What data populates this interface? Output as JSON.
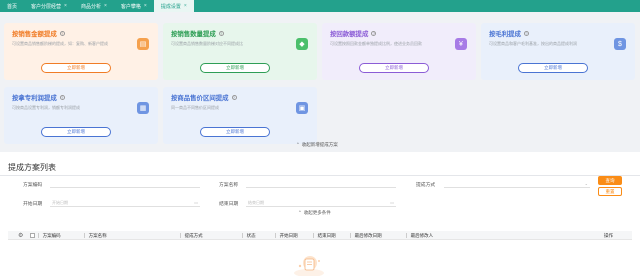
{
  "tabs": [
    {
      "label": "首页",
      "closable": false,
      "active": false
    },
    {
      "label": "客户分层经营",
      "closable": true,
      "active": false
    },
    {
      "label": "商品分析",
      "closable": true,
      "active": false
    },
    {
      "label": "客户攀格",
      "closable": true,
      "active": false
    },
    {
      "label": "提成设置",
      "closable": true,
      "active": true
    }
  ],
  "cards": [
    {
      "title": "按销售金额提成",
      "desc": "可设置商品销售额阶梯的提成，如：复购、新客户提成",
      "button": "立即新增",
      "color": "orange",
      "icon": "coin-box-icon"
    },
    {
      "title": "按销售数量提成",
      "desc": "可设置商品销售数量阶梯对应不同提成比",
      "button": "立即新增",
      "color": "green",
      "icon": "box-icon"
    },
    {
      "title": "按回款额提成",
      "desc": "可设置按照回款金额单独提成比例，使进业务员回款",
      "button": "立即新增",
      "color": "purple",
      "icon": "money-icon"
    },
    {
      "title": "按毛利提成",
      "desc": "可设置商品和客户毛利基准，按出的商品提成利润",
      "button": "立即新增",
      "color": "blue",
      "icon": "money-bag-icon"
    },
    {
      "title": "按拿专利润提成",
      "desc": "可按商品设置专利润，销额专利润提成",
      "button": "立即新增",
      "color": "blue",
      "icon": "chart-doc-icon"
    },
    {
      "title": "按商品售价区间提成",
      "desc": "同一商品不同售价区间提成",
      "button": "立即新增",
      "color": "blue",
      "icon": "price-tag-icon"
    }
  ],
  "collapse_cards": "收起新增提成方案",
  "list": {
    "title": "提成方案列表",
    "filters": {
      "code_label": "方案编码",
      "name_label": "方案名称",
      "mode_label": "提成方式",
      "start_label": "开始日期",
      "start_placeholder": "开始日期",
      "end_label": "结束日期",
      "end_placeholder": "结束日期"
    },
    "search_button": "查询",
    "reset_button": "重置",
    "collapse_filters": "收起更多条件",
    "columns": [
      "方案编码",
      "方案名称",
      "提成方式",
      "状态",
      "开始日期",
      "结束日期",
      "最后修改日期",
      "最后修改人",
      "操作"
    ]
  }
}
